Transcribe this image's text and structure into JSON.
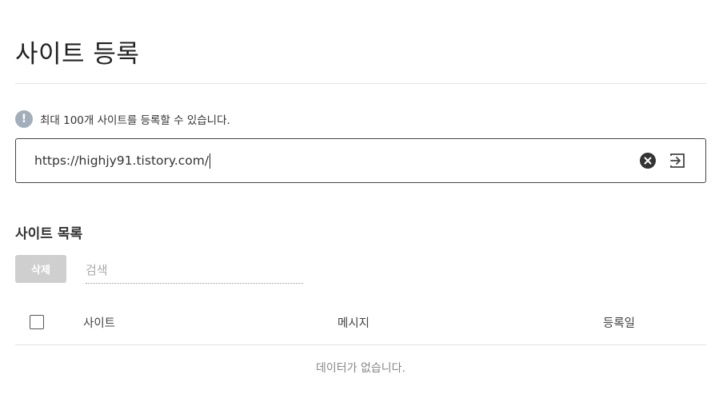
{
  "page": {
    "title": "사이트 등록"
  },
  "notice": {
    "icon": "info-icon",
    "text": "최대 100개 사이트를 등록할 수 있습니다."
  },
  "url_field": {
    "value": "https://highjy91.tistory.com/",
    "clear_icon": "close-circle-icon",
    "submit_icon": "enter-icon"
  },
  "site_list": {
    "title": "사이트 목록",
    "delete_label": "삭제",
    "search_placeholder": "검색",
    "columns": [
      "사이트",
      "메시지",
      "등록일"
    ],
    "empty_text": "데이터가 없습니다."
  },
  "colors": {
    "delete_button_bg": "#cfcfcf",
    "info_icon_bg": "#a3aebb",
    "clear_icon_bg": "#333333"
  }
}
